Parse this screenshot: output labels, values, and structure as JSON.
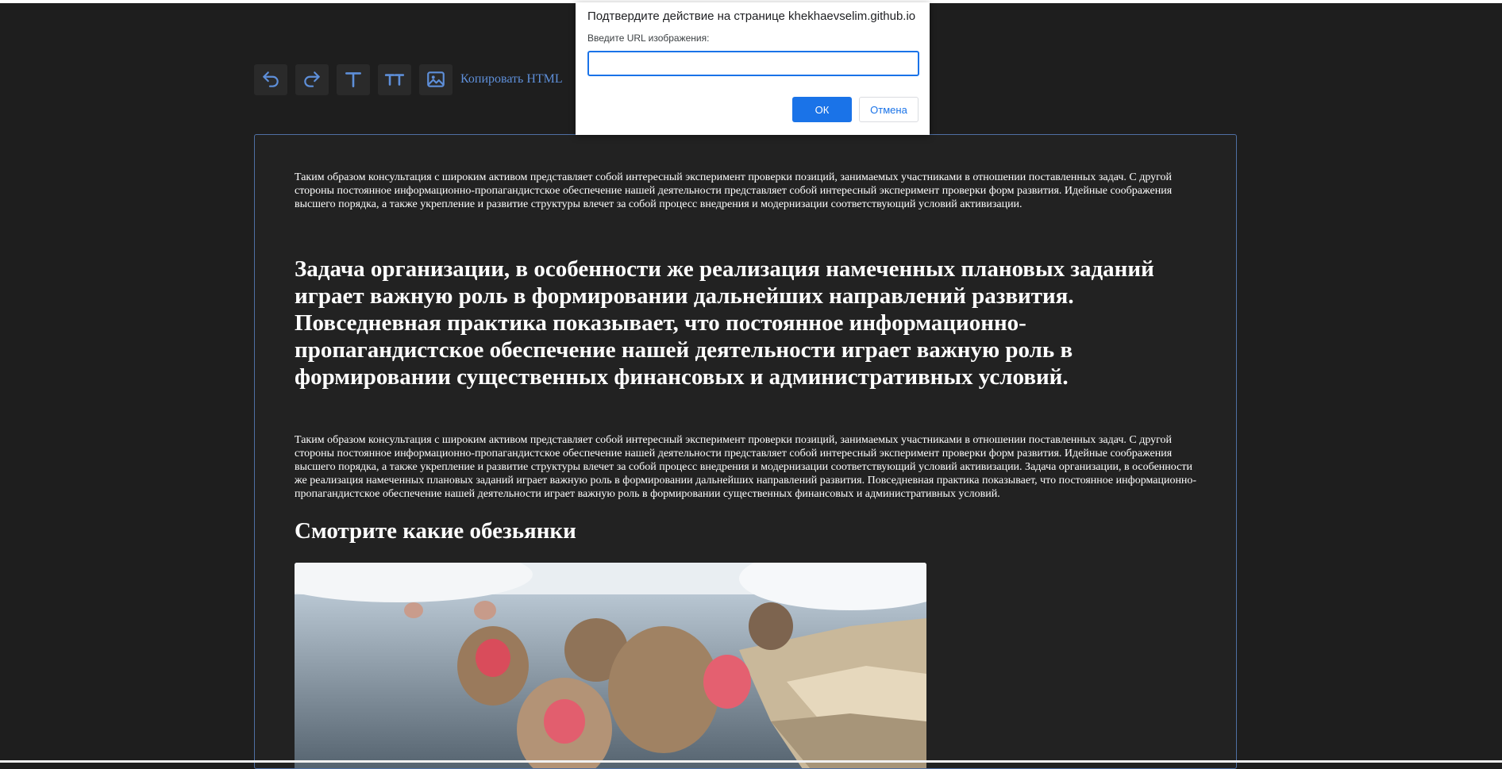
{
  "toolbar": {
    "buttons": [
      {
        "icon": "undo-icon"
      },
      {
        "icon": "redo-icon"
      },
      {
        "icon": "text-icon"
      },
      {
        "icon": "heading-icon"
      },
      {
        "icon": "image-icon"
      }
    ],
    "copy_label": "Копировать HTML",
    "accent_color": "#5e8fd9"
  },
  "editor": {
    "paragraph1": "Таким образом консультация с широким активом представляет собой интересный эксперимент проверки позиций, занимаемых участниками в отношении поставленных задач. С другой стороны постоянное информационно-пропагандистское обеспечение нашей деятельности представляет собой интересный эксперимент проверки форм развития. Идейные соображения высшего порядка, а также укрепление и развитие структуры влечет за собой процесс внедрения и модернизации соответствующий условий активизации.",
    "heading1": "Задача организации, в особенности же реализация намеченных плановых заданий играет важную роль в формировании дальнейших направлений развития. Повседневная практика показывает, что постоянное информационно-пропагандистское обеспечение нашей деятельности играет важную роль в формировании существенных финансовых и административных условий.",
    "paragraph2": "Таким образом консультация с широким активом представляет собой интересный эксперимент проверки позиций, занимаемых участниками в отношении поставленных задач. С другой стороны постоянное информационно-пропагандистское обеспечение нашей деятельности представляет собой интересный эксперимент проверки форм развития. Идейные соображения высшего порядка, а также укрепление и развитие структуры влечет за собой процесс внедрения и модернизации соответствующий условий активизации. Задача организации, в особенности же реализация намеченных плановых заданий играет важную роль в формировании дальнейших направлений развития. Повседневная практика показывает, что постоянное информационно-пропагандистское обеспечение нашей деятельности играет важную роль в формировании существенных финансовых и административных условий.",
    "heading2": "Смотрите какие обезьянки",
    "border_color": "#4f6fa3"
  },
  "dialog": {
    "title": "Подтвердите действие на странице khekhaevselim.github.io",
    "label": "Введите URL изображения:",
    "input_value": "",
    "ok_label": "ОК",
    "cancel_label": "Отмена",
    "primary_color": "#1a73e8"
  }
}
